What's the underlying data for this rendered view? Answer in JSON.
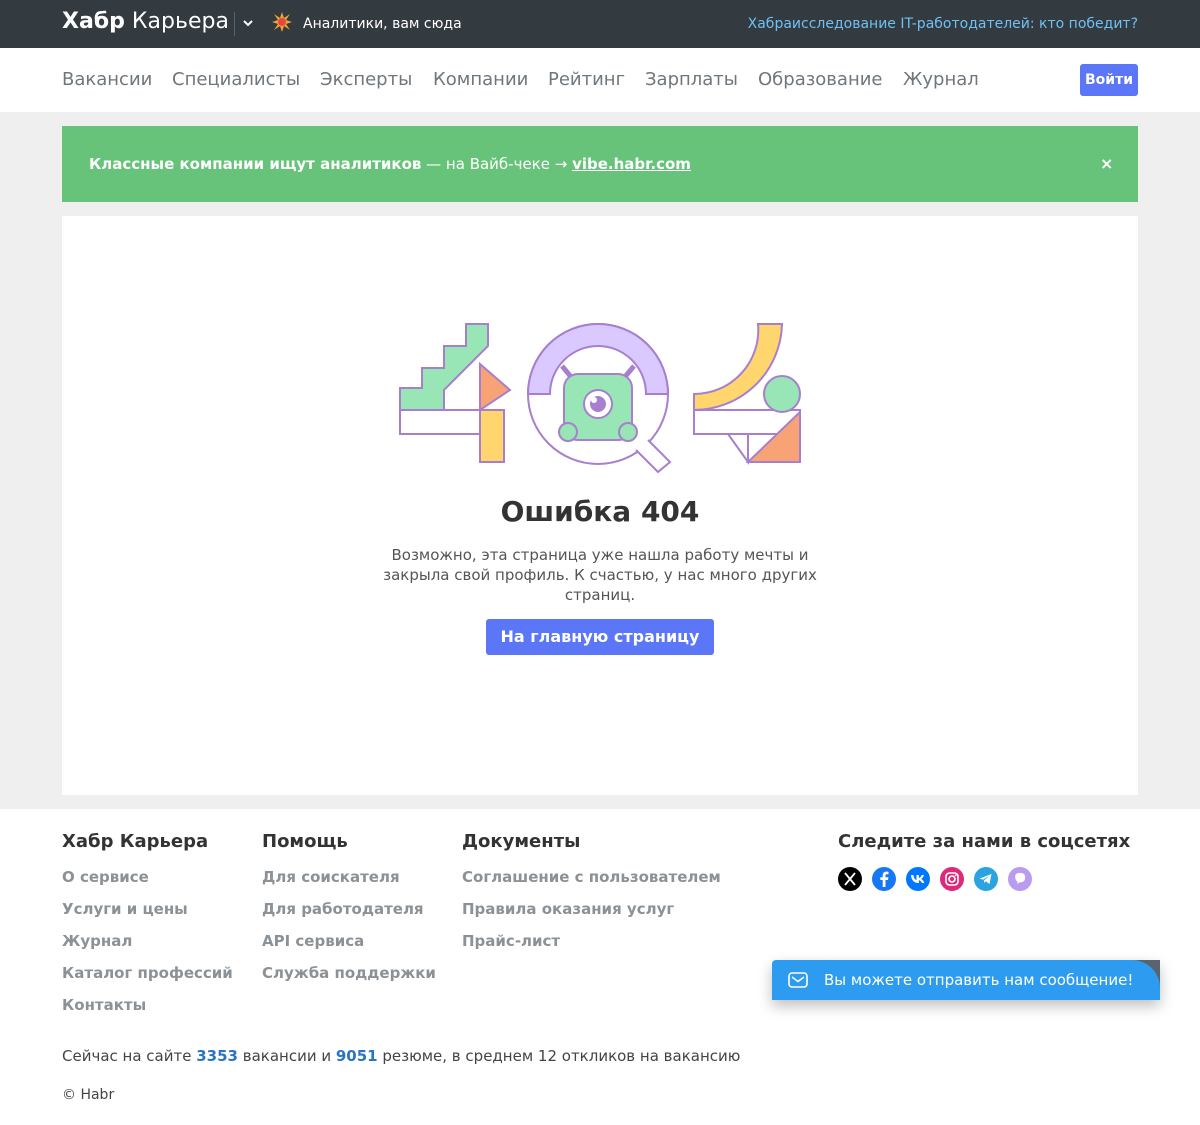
{
  "topbar": {
    "brand_bold": "Хабр",
    "brand_rest": " Карьера",
    "promo_text": "Аналитики, вам сюда",
    "right_link": "Хабраисследование IT-работодателей: кто победит?"
  },
  "nav": {
    "items": [
      "Вакансии",
      "Специалисты",
      "Эксперты",
      "Компании",
      "Рейтинг",
      "Зарплаты",
      "Образование",
      "Журнал"
    ],
    "login": "Войти"
  },
  "banner": {
    "icon": "",
    "bold": "Классные компании ищут аналитиков",
    "middle": " — на Вайб-чеке → ",
    "link": "vibe.habr.com",
    "close": "×"
  },
  "error": {
    "title": "Ошибка 404",
    "description": "Возможно, эта страница уже нашла работу мечты и закрыла свой профиль. К счастью, у нас много других страниц.",
    "button": "На главную страницу"
  },
  "footer": {
    "col1": {
      "title": "Хабр Карьера",
      "links": [
        "О сервисе",
        "Услуги и цены",
        "Журнал",
        "Каталог профессий",
        "Контакты"
      ]
    },
    "col2": {
      "title": "Помощь",
      "links": [
        "Для соискателя",
        "Для работодателя",
        "API сервиса",
        "Служба поддержки"
      ]
    },
    "col3": {
      "title": "Документы",
      "links": [
        "Соглашение с пользователем",
        "Правила оказания услуг",
        "Прайс-лист"
      ]
    },
    "col4": {
      "title": "Следите за нами в соцсетях",
      "icons": [
        "x-icon",
        "facebook-icon",
        "vk-icon",
        "instagram-icon",
        "telegram-icon",
        "viber-icon"
      ]
    },
    "stats": {
      "prefix": "Сейчас на сайте ",
      "vacancies": "3353",
      "mid": " вакансии и ",
      "resumes": "9051",
      "suffix": " резюме, в среднем 12 откликов на вакансию"
    },
    "copyright": "© Habr"
  },
  "chat": {
    "text": "Вы можете отправить нам сообщение!"
  },
  "colors": {
    "accent": "#5b76f7",
    "banner": "#67c37a",
    "topbar": "#333a40",
    "chat": "#2d9cf0"
  }
}
